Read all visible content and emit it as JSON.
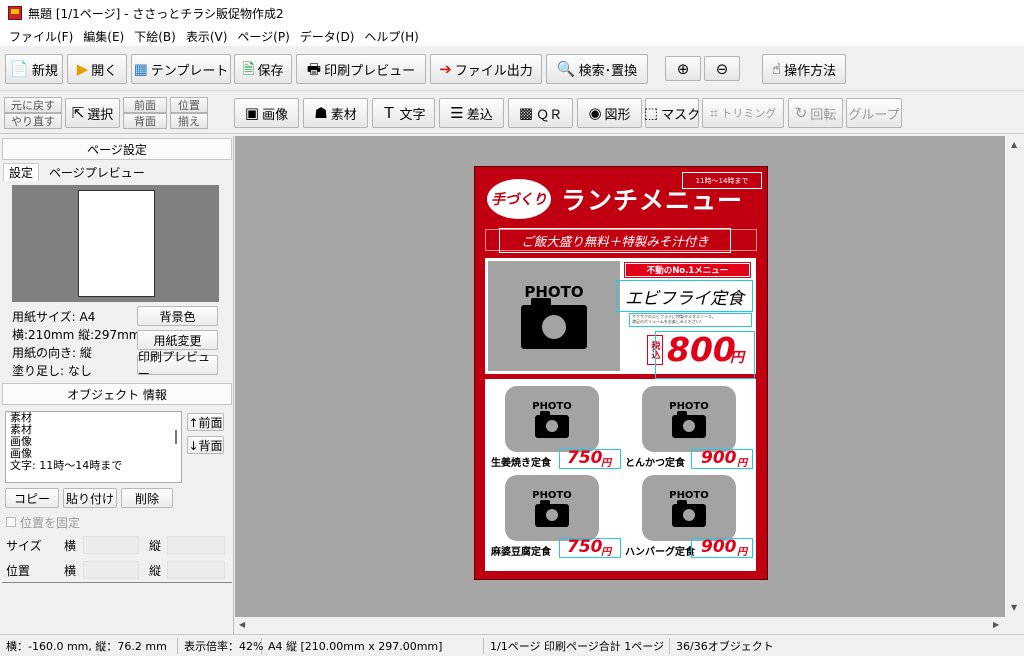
{
  "window": {
    "title": "無題 [1/1ページ] - ささっとチラシ販促物作成2"
  },
  "menu": [
    "ファイル(F)",
    "編集(E)",
    "下絵(B)",
    "表示(V)",
    "ページ(P)",
    "データ(D)",
    "ヘルプ(H)"
  ],
  "toolbar1": {
    "new": "新規",
    "open": "開く",
    "template": "テンプレート",
    "save": "保存",
    "print_preview": "印刷プレビュー",
    "file_output": "ファイル出力",
    "search_replace": "検索･置換",
    "zoom_in": "⊕",
    "zoom_out": "⊖",
    "help": "操作方法"
  },
  "toolbar2": {
    "undo": "元に戻す",
    "redo": "やり直す",
    "select": "選択",
    "front": "前面",
    "back": "背面",
    "align_top": "位置",
    "align_bottom": "揃え",
    "image": "画像",
    "material": "素材",
    "text": "文字",
    "insert": "差込",
    "qr": "ＱＲ",
    "shape": "図形",
    "mask": "マスク",
    "trimming": "トリミング",
    "rotate": "回転",
    "group": "グループ"
  },
  "page_settings": {
    "header": "ページ設定",
    "tab_settings": "設定",
    "tab_preview": "ページプレビュー",
    "paper_size": "用紙サイズ: A4",
    "dimensions": "横:210mm 縦:297mm",
    "orientation": "用紙の向き: 縦",
    "bleed": "塗り足し: なし",
    "bg_color_btn": "背景色",
    "paper_change_btn": "用紙変更",
    "print_preview_btn": "印刷プレビュー"
  },
  "object_info": {
    "header": "オブジェクト 情報",
    "items": [
      "素材",
      "素材",
      "画像",
      "画像",
      "文字: 11時～14時まで"
    ],
    "front_btn": "↑前面",
    "back_btn": "↓背面",
    "copy_btn": "コピー",
    "paste_btn": "貼り付け",
    "delete_btn": "削除",
    "lock_label": "位置を固定",
    "size_label": "サイズ",
    "pos_label": "位置",
    "width_label": "横",
    "height_label": "縦"
  },
  "poster": {
    "hours": "11時～14時まで",
    "logo": "手づくり",
    "title": "ランチメニュー",
    "subtitle": "ご飯大盛り無料＋特製みそ汁付き",
    "featured_badge": "不動のNo.1メニュー",
    "featured_name": "エビフライ定食",
    "featured_desc1": "サクサクのエビフライに特製タルタルソース。",
    "featured_desc2": "満足のボリュームをお楽しみください！",
    "tax_label": "税込",
    "featured_price": "800",
    "yen": "円",
    "photo_label": "PHOTO",
    "items": [
      {
        "name": "生姜焼き定食",
        "price": "750"
      },
      {
        "name": "とんかつ定食",
        "price": "900"
      },
      {
        "name": "麻婆豆腐定食",
        "price": "750"
      },
      {
        "name": "ハンバーグ定食",
        "price": "900"
      }
    ]
  },
  "status": {
    "cursor": "横：-160.0 mm, 縦：76.2 mm",
    "zoom": "表示倍率：42%",
    "paper": "A4 縦 [210.00mm x 297.00mm]",
    "page": "1/1ページ 印刷ページ合計 1ページ",
    "objects": "36/36オブジェクト"
  },
  "colors": {
    "poster_bg": "#c00010",
    "selection": "#27c7e8",
    "price_red": "#e00018"
  }
}
